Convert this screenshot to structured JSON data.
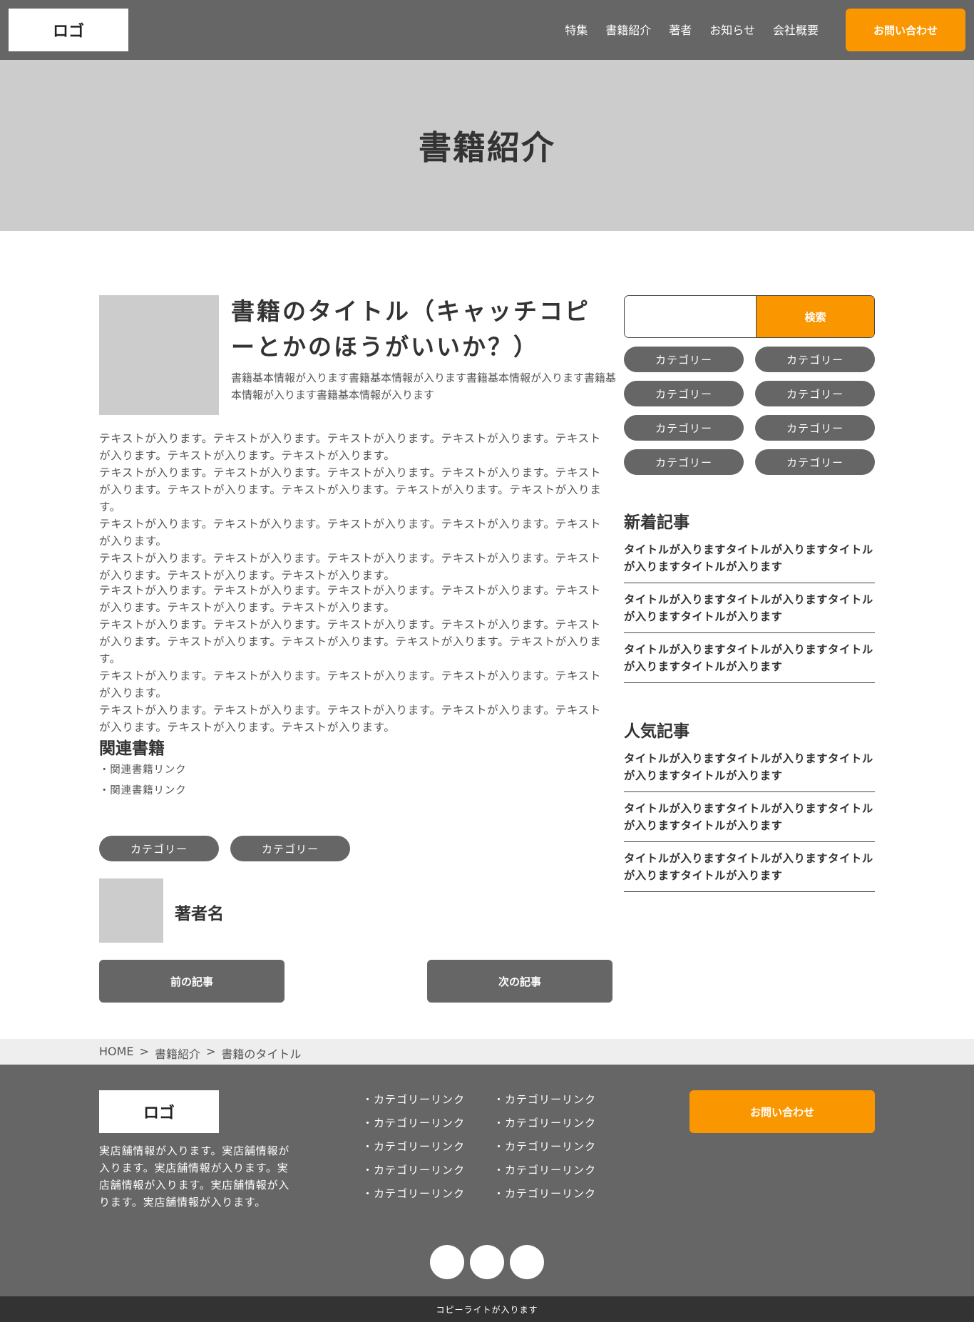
{
  "header": {
    "logo": "ロゴ",
    "nav": [
      "特集",
      "書籍紹介",
      "著者",
      "お知らせ",
      "会社概要"
    ],
    "contact_label": "お問い合わせ"
  },
  "hero": {
    "title": "書籍紹介"
  },
  "book": {
    "title": "書籍のタイトル（キャッチコピーとかのほうがいいか？）",
    "info": "書籍基本情報が入ります書籍基本情報が入ります書籍基本情報が入ります書籍基本情報が入ります書籍基本情報が入ります",
    "paragraph1": "テキストが入ります。テキストが入ります。テキストが入ります。テキストが入ります。テキストが入ります。テキストが入ります。テキストが入ります。\nテキストが入ります。テキストが入ります。テキストが入ります。テキストが入ります。テキストが入ります。テキストが入ります。テキストが入ります。テキストが入ります。テキストが入ります。\nテキストが入ります。テキストが入ります。テキストが入ります。テキストが入ります。テキストが入ります。\nテキストが入ります。テキストが入ります。テキストが入ります。テキストが入ります。テキストが入ります。テキストが入ります。テキストが入ります。",
    "paragraph2": "テキストが入ります。テキストが入ります。テキストが入ります。テキストが入ります。テキストが入ります。テキストが入ります。テキストが入ります。\nテキストが入ります。テキストが入ります。テキストが入ります。テキストが入ります。テキストが入ります。テキストが入ります。テキストが入ります。テキストが入ります。テキストが入ります。\nテキストが入ります。テキストが入ります。テキストが入ります。テキストが入ります。テキストが入ります。\nテキストが入ります。テキストが入ります。テキストが入ります。テキストが入ります。テキストが入ります。テキストが入ります。テキストが入ります。",
    "related_heading": "関連書籍",
    "related_links": [
      "・関連書籍リンク",
      "・関連書籍リンク"
    ],
    "tags": [
      "カテゴリー",
      "カテゴリー"
    ],
    "author_name": "著者名",
    "prev_label": "前の記事",
    "next_label": "次の記事"
  },
  "sidebar": {
    "search_placeholder": "",
    "search_label": "検索",
    "categories": [
      "カテゴリー",
      "カテゴリー",
      "カテゴリー",
      "カテゴリー",
      "カテゴリー",
      "カテゴリー",
      "カテゴリー",
      "カテゴリー"
    ],
    "new_heading": "新着記事",
    "new_items": [
      "タイトルが入りますタイトルが入りますタイトルが入りますタイトルが入ります",
      "タイトルが入りますタイトルが入りますタイトルが入りますタイトルが入ります",
      "タイトルが入りますタイトルが入りますタイトルが入りますタイトルが入ります"
    ],
    "popular_heading": "人気記事",
    "popular_items": [
      "タイトルが入りますタイトルが入りますタイトルが入りますタイトルが入ります",
      "タイトルが入りますタイトルが入りますタイトルが入りますタイトルが入ります",
      "タイトルが入りますタイトルが入りますタイトルが入りますタイトルが入ります"
    ]
  },
  "breadcrumb": [
    "HOME",
    ">",
    "書籍紹介",
    ">",
    "書籍のタイトル"
  ],
  "footer": {
    "logo": "ロゴ",
    "info": "実店舗情報が入ります。実店舗情報が入ります。実店舗情報が入ります。実店舗情報が入ります。実店舗情報が入ります。実店舗情報が入ります。",
    "links_col1": [
      "・カテゴリーリンク",
      "・カテゴリーリンク",
      "・カテゴリーリンク",
      "・カテゴリーリンク",
      "・カテゴリーリンク"
    ],
    "links_col2": [
      "・カテゴリーリンク",
      "・カテゴリーリンク",
      "・カテゴリーリンク",
      "・カテゴリーリンク",
      "・カテゴリーリンク"
    ],
    "contact_label": "お問い合わせ",
    "social_icons": [
      "social-icon",
      "social-icon",
      "social-icon"
    ],
    "copyright": "コピーライトが入ります"
  },
  "colors": {
    "accent": "#fa9600",
    "dark": "#666666",
    "placeholder": "#cccccc"
  }
}
